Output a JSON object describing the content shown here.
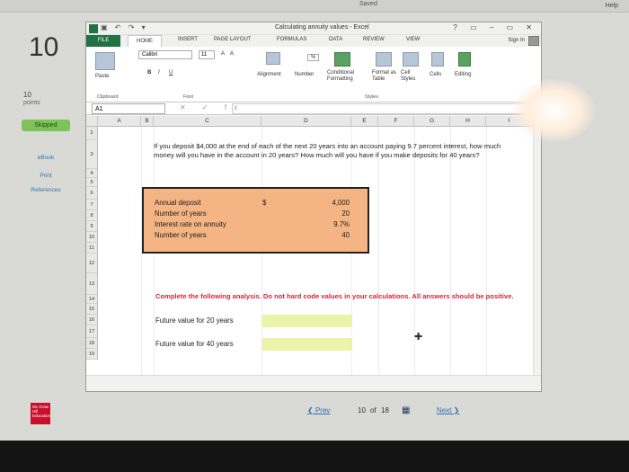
{
  "browser": {
    "saved": "Saved",
    "help": "Help"
  },
  "question": {
    "number": "10",
    "points_value": "10",
    "points_label": "points",
    "status": "Skipped"
  },
  "sidebar_links": [
    "eBook",
    "Print",
    "References"
  ],
  "excel": {
    "title": "Calculating annuity values - Excel",
    "window_controls": "? ▭ – ▭ ✕",
    "tabs": [
      "FILE",
      "HOME",
      "INSERT",
      "PAGE LAYOUT",
      "FORMULAS",
      "DATA",
      "REVIEW",
      "VIEW"
    ],
    "sign_in": "Sign In",
    "ribbon": {
      "paste": "Paste",
      "clipboard": "Clipboard",
      "font_name": "Calibri",
      "font_size": "11",
      "bold": "B",
      "italic": "I",
      "underline": "U",
      "font_group": "Font",
      "alignment": "Alignment",
      "number": "Number",
      "percent": "%",
      "conditional_formatting": "Conditional Formatting",
      "format_as_table": "Format as Table",
      "cell_styles": "Cell Styles",
      "styles_group": "Styles",
      "cells": "Cells",
      "editing": "Editing",
      "grow_font": "A",
      "shrink_font": "A"
    },
    "name_box": "A1",
    "fx_controls": "✕ ✓ fx",
    "columns": [
      "A",
      "B",
      "C",
      "D",
      "E",
      "F",
      "G",
      "H",
      "I"
    ],
    "rows": [
      "2",
      "3",
      "4",
      "5",
      "6",
      "7",
      "8",
      "9",
      "10",
      "11",
      "12",
      "13",
      "14",
      "15",
      "16",
      "17",
      "18",
      "19"
    ],
    "question_text": "If you deposit $4,000 at the end of each of the next 20 years into an account paying 9.7 percent interest, how much money will you have in the account in 20 years? How much will you have if you make deposits for 40 years?",
    "inputs": [
      {
        "label": "Annual deposit",
        "prefix": "$",
        "value": "4,000"
      },
      {
        "label": "Number of years",
        "prefix": "",
        "value": "20"
      },
      {
        "label": "Interest rate on annuity",
        "prefix": "",
        "value": "9.7%"
      },
      {
        "label": "Number of years",
        "prefix": "",
        "value": "40"
      }
    ],
    "instructions": "Complete the following analysis. Do not hard code values in your calculations. All answers should be positive.",
    "outputs": [
      {
        "label": "Future value for 20 years",
        "value": ""
      },
      {
        "label": "Future value for 40 years",
        "value": ""
      }
    ],
    "input_fill_color": "#f5b483",
    "answer_fill_color": "#e9f4a8",
    "instruction_color": "#d6243c"
  },
  "pagination": {
    "prev": "Prev",
    "current": "10",
    "of": "of",
    "total": "18",
    "next": "Next"
  },
  "brand": {
    "logo_text": "Mc Graw Hill Education"
  }
}
